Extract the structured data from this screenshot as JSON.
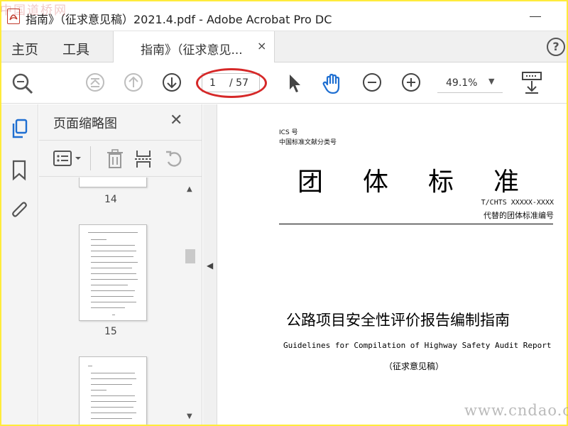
{
  "window": {
    "title": "指南》（征求意见稿）2021.4.pdf - Adobe Acrobat Pro DC",
    "watermark_top_left": "中国道桥网",
    "watermark_bottom_right": "www.cndao.com"
  },
  "tabs": {
    "home": "主页",
    "tools": "工具",
    "document": "指南》（征求意见...",
    "close_symbol": "×",
    "help_symbol": "?"
  },
  "toolbar": {
    "page_current": "1",
    "page_total": "/ 57",
    "zoom": "49.1%",
    "zoom_dropdown_symbol": "▼"
  },
  "thumbnail_panel": {
    "title": "页面缩略图",
    "close_symbol": "✕",
    "pages": [
      "14",
      "15"
    ]
  },
  "document": {
    "ics": "ICS 号",
    "category": "中国标准文献分类号",
    "heading": "团体标准",
    "standard_number": "T/CHTS XXXXX-XXXX",
    "replaces": "代替的团体标准编号",
    "title_cn": "公路项目安全性评价报告编制指南",
    "title_en": "Guidelines for Compilation of Highway Safety Audit Report",
    "draft_note": "（征求意见稿）"
  },
  "colors": {
    "border": "#ffeb3b",
    "annotation": "#d62828",
    "hand_tool": "#1f6fd1",
    "rail_active": "#1f6fd1"
  }
}
